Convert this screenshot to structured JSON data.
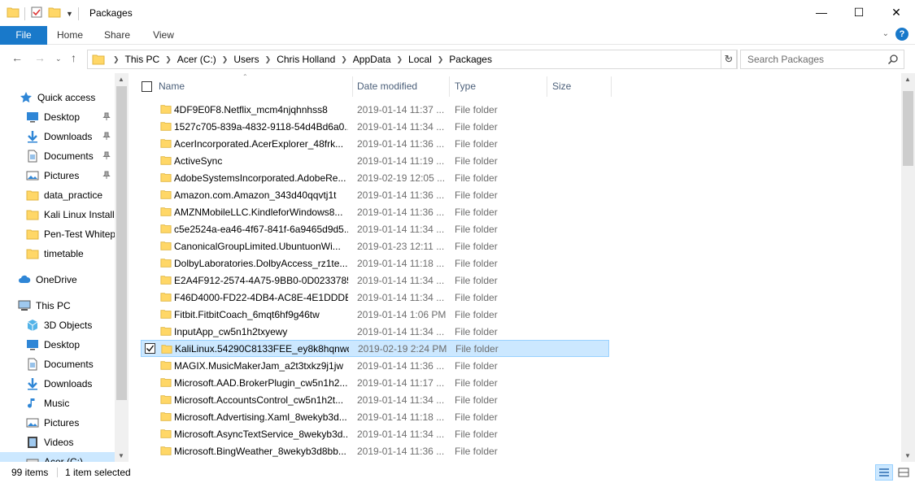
{
  "window": {
    "title": "Packages",
    "minimize_glyph": "—",
    "maximize_glyph": "☐",
    "close_glyph": "✕"
  },
  "ribbon": {
    "tabs": [
      "File",
      "Home",
      "Share",
      "View"
    ],
    "help_glyph": "?"
  },
  "address": {
    "crumbs": [
      "This PC",
      "Acer (C:)",
      "Users",
      "Chris Holland",
      "AppData",
      "Local",
      "Packages"
    ]
  },
  "search": {
    "placeholder": "Search Packages"
  },
  "sidebar": {
    "items": [
      {
        "label": "Quick access",
        "icon": "star-icon",
        "pinned": false
      },
      {
        "label": "Desktop",
        "icon": "desktop-icon",
        "pinned": true
      },
      {
        "label": "Downloads",
        "icon": "downloads-icon",
        "pinned": true
      },
      {
        "label": "Documents",
        "icon": "documents-icon",
        "pinned": true
      },
      {
        "label": "Pictures",
        "icon": "pictures-icon",
        "pinned": true
      },
      {
        "label": "data_practice",
        "icon": "folder-icon",
        "pinned": false
      },
      {
        "label": "Kali Linux Install",
        "icon": "folder-icon",
        "pinned": false
      },
      {
        "label": "Pen-Test Whitep",
        "icon": "folder-icon",
        "pinned": false
      },
      {
        "label": "timetable",
        "icon": "folder-icon",
        "pinned": false
      },
      {
        "label": "OneDrive",
        "icon": "cloud-icon",
        "pinned": false
      },
      {
        "label": "This PC",
        "icon": "pc-icon",
        "pinned": false
      },
      {
        "label": "3D Objects",
        "icon": "cube-icon",
        "pinned": false
      },
      {
        "label": "Desktop",
        "icon": "desktop-icon",
        "pinned": false
      },
      {
        "label": "Documents",
        "icon": "documents-icon",
        "pinned": false
      },
      {
        "label": "Downloads",
        "icon": "downloads-icon",
        "pinned": false
      },
      {
        "label": "Music",
        "icon": "music-icon",
        "pinned": false
      },
      {
        "label": "Pictures",
        "icon": "pictures-icon",
        "pinned": false
      },
      {
        "label": "Videos",
        "icon": "videos-icon",
        "pinned": false
      },
      {
        "label": "Acer (C:)",
        "icon": "drive-icon",
        "pinned": false
      }
    ]
  },
  "columns": {
    "name": "Name",
    "date": "Date modified",
    "type": "Type",
    "size": "Size"
  },
  "files": [
    {
      "name": "4DF9E0F8.Netflix_mcm4njqhnhss8",
      "date": "2019-01-14 11:37 ...",
      "type": "File folder"
    },
    {
      "name": "1527c705-839a-4832-9118-54d4Bd6a0...",
      "date": "2019-01-14 11:34 ...",
      "type": "File folder"
    },
    {
      "name": "AcerIncorporated.AcerExplorer_48frk...",
      "date": "2019-01-14 11:36 ...",
      "type": "File folder"
    },
    {
      "name": "ActiveSync",
      "date": "2019-01-14 11:19 ...",
      "type": "File folder"
    },
    {
      "name": "AdobeSystemsIncorporated.AdobeRe...",
      "date": "2019-02-19 12:05 ...",
      "type": "File folder"
    },
    {
      "name": "Amazon.com.Amazon_343d40qqvtj1t",
      "date": "2019-01-14 11:36 ...",
      "type": "File folder"
    },
    {
      "name": "AMZNMobileLLC.KindleforWindows8...",
      "date": "2019-01-14 11:36 ...",
      "type": "File folder"
    },
    {
      "name": "c5e2524a-ea46-4f67-841f-6a9465d9d5...",
      "date": "2019-01-14 11:34 ...",
      "type": "File folder"
    },
    {
      "name": "CanonicalGroupLimited.UbuntuonWi...",
      "date": "2019-01-23 12:11 ...",
      "type": "File folder"
    },
    {
      "name": "DolbyLaboratories.DolbyAccess_rz1te...",
      "date": "2019-01-14 11:18 ...",
      "type": "File folder"
    },
    {
      "name": "E2A4F912-2574-4A75-9BB0-0D0233785...",
      "date": "2019-01-14 11:34 ...",
      "type": "File folder"
    },
    {
      "name": "F46D4000-FD22-4DB4-AC8E-4E1DDDE...",
      "date": "2019-01-14 11:34 ...",
      "type": "File folder"
    },
    {
      "name": "Fitbit.FitbitCoach_6mqt6hf9g46tw",
      "date": "2019-01-14 1:06 PM",
      "type": "File folder"
    },
    {
      "name": "InputApp_cw5n1h2txyewy",
      "date": "2019-01-14 11:34 ...",
      "type": "File folder"
    },
    {
      "name": "KaliLinux.54290C8133FEE_ey8k8hqnwq...",
      "date": "2019-02-19 2:24 PM",
      "type": "File folder",
      "selected": true
    },
    {
      "name": "MAGIX.MusicMakerJam_a2t3txkz9j1jw",
      "date": "2019-01-14 11:36 ...",
      "type": "File folder"
    },
    {
      "name": "Microsoft.AAD.BrokerPlugin_cw5n1h2...",
      "date": "2019-01-14 11:17 ...",
      "type": "File folder"
    },
    {
      "name": "Microsoft.AccountsControl_cw5n1h2t...",
      "date": "2019-01-14 11:34 ...",
      "type": "File folder"
    },
    {
      "name": "Microsoft.Advertising.Xaml_8wekyb3d...",
      "date": "2019-01-14 11:18 ...",
      "type": "File folder"
    },
    {
      "name": "Microsoft.AsyncTextService_8wekyb3d...",
      "date": "2019-01-14 11:34 ...",
      "type": "File folder"
    },
    {
      "name": "Microsoft.BingWeather_8wekyb3d8bb...",
      "date": "2019-01-14 11:36 ...",
      "type": "File folder"
    }
  ],
  "status": {
    "count": "99 items",
    "selection": "1 item selected"
  },
  "colors": {
    "accent": "#1979ca",
    "selection": "#cce8ff",
    "selection_border": "#99d1ff",
    "folder": "#ffd767"
  }
}
